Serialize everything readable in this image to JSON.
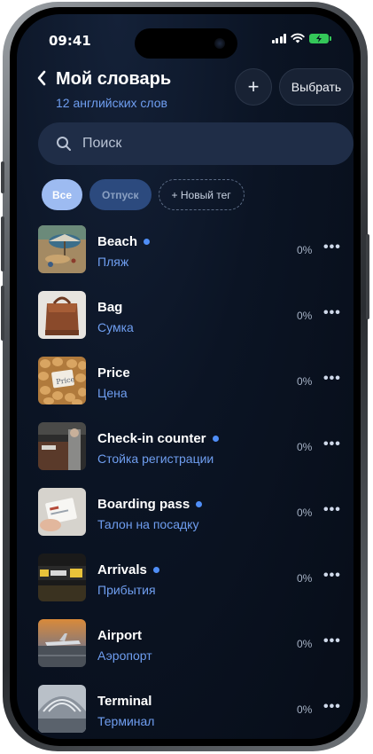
{
  "status": {
    "time": "09:41",
    "battery": ""
  },
  "header": {
    "title": "Мой словарь",
    "subtitle": "12 английских слов",
    "add_label": "+",
    "select_label": "Выбрать"
  },
  "search": {
    "placeholder": "Поиск"
  },
  "tags": [
    {
      "label": "Все"
    },
    {
      "label": "Отпуск"
    },
    {
      "label": "+ Новый тег"
    }
  ],
  "words": [
    {
      "word": "Beach",
      "translation": "Пляж",
      "progress": "0%",
      "new": true
    },
    {
      "word": "Bag",
      "translation": "Сумка",
      "progress": "0%",
      "new": false
    },
    {
      "word": "Price",
      "translation": "Цена",
      "progress": "0%",
      "new": false
    },
    {
      "word": "Check-in counter",
      "translation": "Стойка регистрации",
      "progress": "0%",
      "new": true
    },
    {
      "word": "Boarding pass",
      "translation": "Талон на посадку",
      "progress": "0%",
      "new": true
    },
    {
      "word": "Arrivals",
      "translation": "Прибытия",
      "progress": "0%",
      "new": true
    },
    {
      "word": "Airport",
      "translation": "Аэропорт",
      "progress": "0%",
      "new": false
    },
    {
      "word": "Terminal",
      "translation": "Терминал",
      "progress": "0%",
      "new": false
    }
  ],
  "more_label": "•••",
  "colors": {
    "accent": "#4f8ef7",
    "subtitle": "#6f9ef0",
    "background": "#0b1424"
  }
}
